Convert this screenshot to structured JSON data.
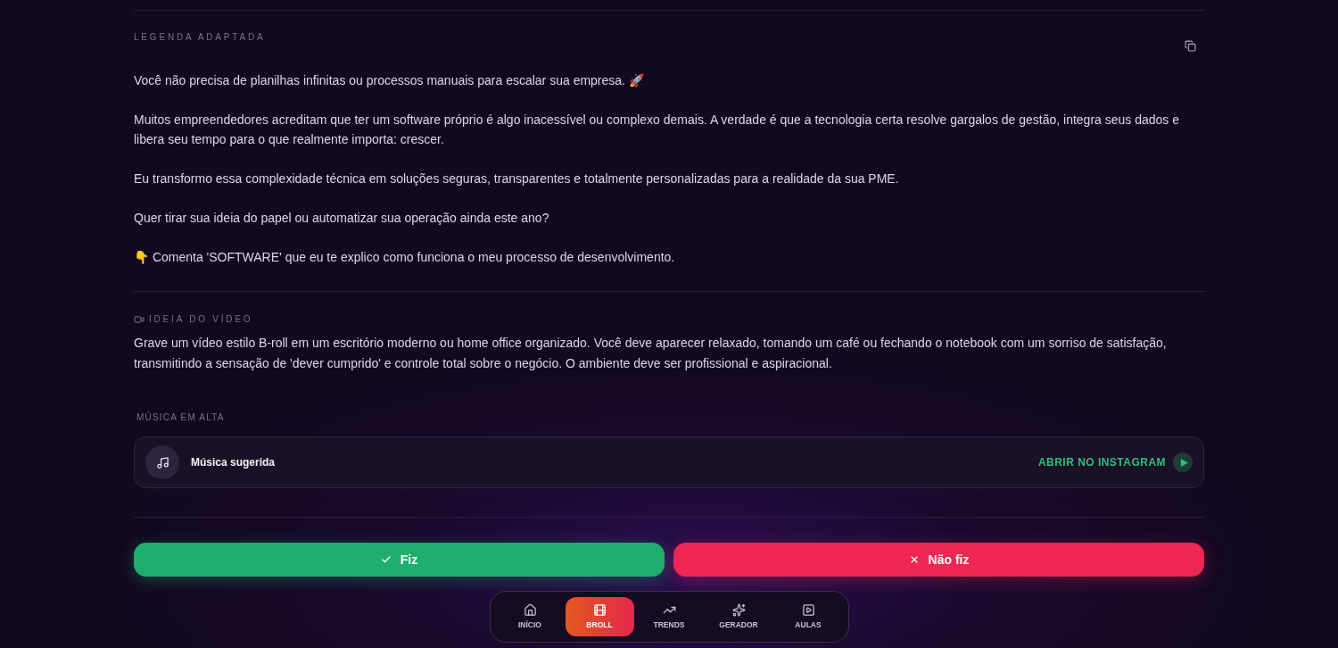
{
  "caption": {
    "label": "LEGENDA ADAPTADA",
    "paragraphs": [
      "Você não precisa de planilhas infinitas ou processos manuais para escalar sua empresa. 🚀",
      "Muitos empreendedores acreditam que ter um software próprio é algo inacessível ou complexo demais. A verdade é que a tecnologia certa resolve gargalos de gestão, integra seus dados e libera seu tempo para o que realmente importa: crescer.",
      "Eu transformo essa complexidade técnica em soluções seguras, transparentes e totalmente personalizadas para a realidade da sua PME.",
      "Quer tirar sua ideia do papel ou automatizar sua operação ainda este ano?",
      "👇 Comenta 'SOFTWARE' que eu te explico como funciona o meu processo de desenvolvimento."
    ]
  },
  "video_idea": {
    "label": "IDEIA DO VÍDEO",
    "text": "Grave um vídeo estilo B-roll em um escritório moderno ou home office organizado. Você deve aparecer relaxado, tomando um café ou fechando o notebook com um sorriso de satisfação, transmitindo a sensação de 'dever cumprido' e controle total sobre o negócio. O ambiente deve ser profissional e aspiracional."
  },
  "music": {
    "label": "MÚSICA EM ALTA",
    "title": "Música sugerida",
    "link": "ABRIR NO INSTAGRAM"
  },
  "actions": [
    {
      "label": "Fiz",
      "kind": "done"
    },
    {
      "label": "Não fiz",
      "kind": "not_done"
    }
  ],
  "nav": [
    {
      "label": "INÍCIO",
      "selected": false
    },
    {
      "label": "BROLL",
      "selected": true
    },
    {
      "label": "TRENDS",
      "selected": false
    },
    {
      "label": "GERADOR",
      "selected": false
    },
    {
      "label": "AULAS",
      "selected": false
    }
  ]
}
